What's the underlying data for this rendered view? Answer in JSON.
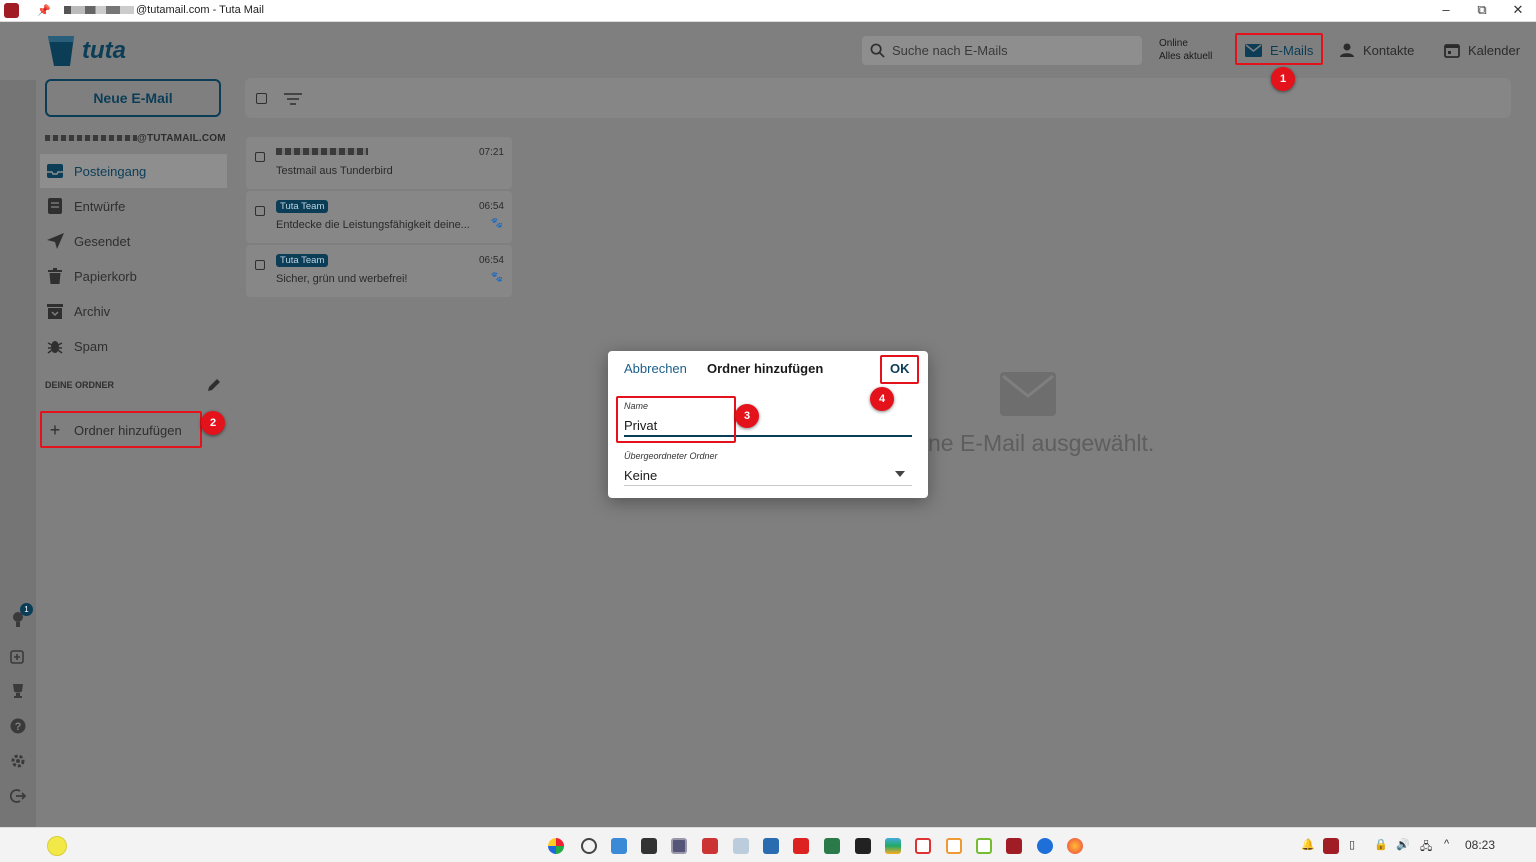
{
  "window": {
    "title_suffix": "@tutamail.com - Tuta Mail",
    "controls": [
      "–",
      "⧉",
      "✕"
    ]
  },
  "header": {
    "logo_text": "tuta",
    "search_placeholder": "Suche nach E-Mails",
    "status_line1": "Online",
    "status_line2": "Alles aktuell",
    "nav": [
      {
        "label": "E-Mails",
        "icon": "mail-icon"
      },
      {
        "label": "Kontakte",
        "icon": "person-icon"
      },
      {
        "label": "Kalender",
        "icon": "calendar-icon"
      }
    ]
  },
  "sidebar": {
    "new_mail_label": "Neue E-Mail",
    "account_suffix": "@TUTAMAIL.COM",
    "folders": [
      {
        "label": "Posteingang",
        "icon": "inbox-icon",
        "active": true
      },
      {
        "label": "Entwürfe",
        "icon": "draft-icon"
      },
      {
        "label": "Gesendet",
        "icon": "send-icon"
      },
      {
        "label": "Papierkorb",
        "icon": "trash-icon"
      },
      {
        "label": "Archiv",
        "icon": "archive-icon"
      },
      {
        "label": "Spam",
        "icon": "bug-icon"
      }
    ],
    "section_heading": "DEINE ORDNER",
    "add_folder_label": "Ordner hinzufügen",
    "rail_badge": "1"
  },
  "mail_list": [
    {
      "sender": "",
      "time": "07:21",
      "subject": "Testmail aus Tunderbird",
      "tagged": false
    },
    {
      "sender": "Tuta Team",
      "time": "06:54",
      "subject": "Entdecke die Leistungsfähigkeit deine...",
      "tagged": true
    },
    {
      "sender": "Tuta Team",
      "time": "06:54",
      "subject": "Sicher, grün und werbefrei!",
      "tagged": true
    }
  ],
  "viewer": {
    "empty_text": "ne E-Mail ausgewählt."
  },
  "dialog": {
    "cancel_label": "Abbrechen",
    "title": "Ordner hinzufügen",
    "ok_label": "OK",
    "name_label": "Name",
    "name_value": "Privat",
    "parent_label": "Übergeordneter Ordner",
    "parent_value": "Keine"
  },
  "annotations": [
    "1",
    "2",
    "3",
    "4"
  ],
  "taskbar": {
    "clock": "08:23"
  },
  "colors": {
    "accent": "#0b3d57",
    "annotation": "#e3121b",
    "brand": "#a01d26"
  }
}
